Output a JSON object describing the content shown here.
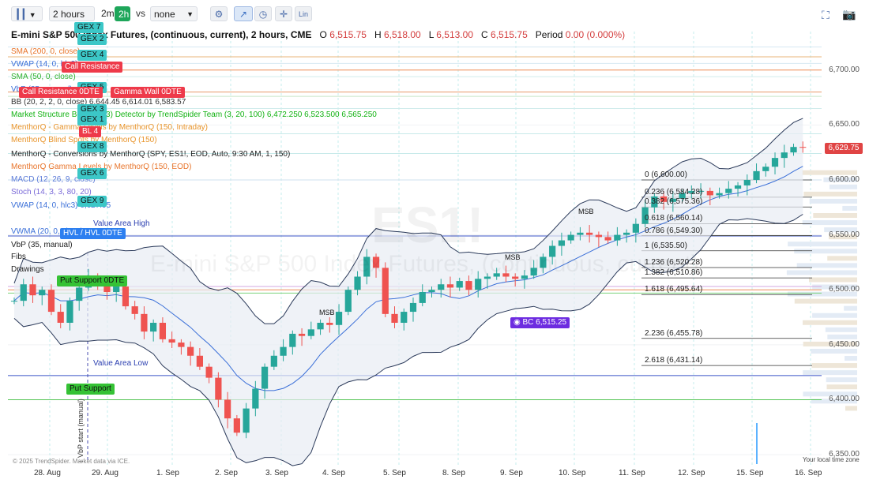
{
  "toolbar": {
    "timeframe": "2 hours",
    "btn_2m": "2m",
    "btn_2h": "2h",
    "vs": "vs",
    "compare": "none",
    "lin": "Lin"
  },
  "header": {
    "title": "E-mini S&P 500 Index Futures, (continuous, current), 2 hours, CME",
    "o_label": "O",
    "o": "6,515.75",
    "h_label": "H",
    "h": "6,518.00",
    "l_label": "L",
    "l": "6,513.00",
    "c_label": "C",
    "c": "6,515.75",
    "period_label": "Period",
    "period": "0.00 (0.000%)"
  },
  "legends": [
    {
      "text": "SMA (200, 0, close)",
      "color": "#e8742a"
    },
    {
      "text": "VWAP (14, 0, hlc3)",
      "color": "#3a6fd8"
    },
    {
      "text": "SMA (50, 0, close)",
      "color": "#2fb12f"
    },
    {
      "text": "VbP (35, manual)",
      "color": "#3a6fd8"
    },
    {
      "text": "BB (20, 2, 2, 0, close) 6,644.45 6,614.01 6,583.57",
      "color": "#333333"
    },
    {
      "text": "Market Structure Break (4, 3) Detector by TrendSpider Team (3, 20, 100)  6,472.250 6,523.500 6,565.250",
      "color": "#12b212"
    },
    {
      "text": "MenthorQ - Gamma Levels by MenthorQ (150, Intraday)",
      "color": "#e8942a"
    },
    {
      "text": "MenthorQ Blind Spots by MenthorQ (150)",
      "color": "#e8942a"
    },
    {
      "text": "MenthorQ - Conversions by MenthorQ (SPY, ES1!, EOD, Auto, 9:30 AM, 1, 150)",
      "color": "#222222"
    },
    {
      "text": "MenthorQ Gamma Levels by MenthorQ (150, EOD)",
      "color": "#e8742a"
    },
    {
      "text": "MACD (12, 26, 9, close)",
      "color": "#5a7ad8"
    },
    {
      "text": "Stoch (14, 3, 3, 80, 20)",
      "color": "#7a6ad8"
    },
    {
      "text": "VWAP (14, 0, hlc3)  6,627.95",
      "color": "#3a6fd8"
    },
    {
      "text": "VWMA (20, 0, close)",
      "color": "#3a6fd8"
    },
    {
      "text": "VbP (35, manual)",
      "color": "#222222"
    },
    {
      "text": "Fibs",
      "color": "#222222"
    },
    {
      "text": "Drawings",
      "color": "#222222"
    }
  ],
  "tags": [
    {
      "text": "GEX 7",
      "cls": "gex"
    },
    {
      "text": "GEX 2",
      "cls": "gex"
    },
    {
      "text": "GEX 4",
      "cls": "gex"
    },
    {
      "text": "Call Resistance",
      "cls": "red"
    },
    {
      "text": "GEX 5",
      "cls": "gex"
    },
    {
      "text": "Call Resistance 0DTE",
      "cls": "red"
    },
    {
      "text": "Gamma Wall 0DTE",
      "cls": "red"
    },
    {
      "text": "GEX 3",
      "cls": "gex"
    },
    {
      "text": "GEX 1",
      "cls": "gex"
    },
    {
      "text": "BL 4",
      "cls": "red"
    },
    {
      "text": "GEX 8",
      "cls": "gex"
    },
    {
      "text": "GEX 6",
      "cls": "gex"
    },
    {
      "text": "GEX 9",
      "cls": "gex"
    },
    {
      "text": "HVL / HVL 0DTE",
      "cls": "blue"
    },
    {
      "text": "Put Support 0DTE",
      "cls": "green"
    },
    {
      "text": "Put Support",
      "cls": "green"
    }
  ],
  "annotations": {
    "value_area_high": "Value Area High",
    "value_area_low": "Value Area Low",
    "bc": "BC 6,515.25",
    "msb": "MSB",
    "vbp_start": "↓ VbP start (manual)",
    "watermark_symbol": "ES1!",
    "watermark_name": "E-mini S&P 500 Index Futures, (continuous, current)",
    "copyright": "© 2025 TrendSpider. Market data via ICE.",
    "timezone": "Your local time zone",
    "last_price": "6,629.75"
  },
  "fib_levels": [
    {
      "text": "0 (6,600.00)",
      "price": 6600.0
    },
    {
      "text": "0.236 (6,584.28)",
      "price": 6584.28
    },
    {
      "text": "0.382 (6,575.36)",
      "price": 6575.36
    },
    {
      "text": "0.618 (6,560.14)",
      "price": 6560.14
    },
    {
      "text": "0.786 (6,549.30)",
      "price": 6549.3
    },
    {
      "text": "1 (6,535.50)",
      "price": 6535.5
    },
    {
      "text": "1.236 (6,520.28)",
      "price": 6520.28
    },
    {
      "text": "1.382 (6,510.86)",
      "price": 6510.86
    },
    {
      "text": "1.618 (6,495.64)",
      "price": 6495.64
    },
    {
      "text": "2.236 (6,455.78)",
      "price": 6455.78
    },
    {
      "text": "2.618 (6,431.14)",
      "price": 6431.14
    }
  ],
  "price_axis": [
    "6,700.00",
    "6,650.00",
    "6,600.00",
    "6,550.00",
    "6,500.00",
    "6,450.00",
    "6,400.00",
    "6,350.00"
  ],
  "time_axis": [
    "28. Aug",
    "29. Aug",
    "1. Sep",
    "2. Sep",
    "3. Sep",
    "4. Sep",
    "5. Sep",
    "8. Sep",
    "9. Sep",
    "10. Sep",
    "11. Sep",
    "12. Sep",
    "15. Sep",
    "16. Sep"
  ],
  "colors": {
    "up": "#26a69a",
    "down": "#ef5350",
    "bb": "#2b3a5a",
    "bb_fill": "#e8edf4"
  },
  "chart_data": {
    "type": "candlestick",
    "ylim": [
      6340,
      6735
    ],
    "close_path": [
      6490,
      6505,
      6495,
      6500,
      6480,
      6470,
      6490,
      6502,
      6512,
      6505,
      6498,
      6503,
      6485,
      6478,
      6462,
      6470,
      6455,
      6452,
      6448,
      6440,
      6430,
      6420,
      6400,
      6383,
      6370,
      6392,
      6410,
      6430,
      6440,
      6448,
      6460,
      6458,
      6464,
      6470,
      6468,
      6480,
      6500,
      6512,
      6530,
      6520,
      6478,
      6470,
      6480,
      6488,
      6498,
      6500,
      6505,
      6502,
      6508,
      6500,
      6510,
      6512,
      6515,
      6512,
      6510,
      6513,
      6520,
      6530,
      6540,
      6545,
      6550,
      6552,
      6550,
      6548,
      6545,
      6550,
      6552,
      6560,
      6575,
      6585,
      6580,
      6583,
      6588,
      6590,
      6590,
      6586,
      6588,
      6592,
      6595,
      6600,
      6608,
      6612,
      6620,
      6625,
      6630,
      6629.75
    ]
  }
}
